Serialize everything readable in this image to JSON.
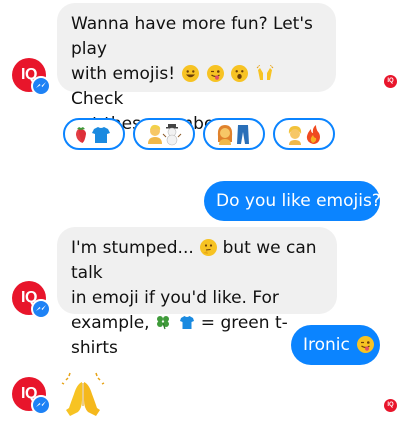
{
  "conversation": {
    "bot_avatar_text": "IQ",
    "receipt_text": "IQ",
    "messages": {
      "m1": {
        "line1": "Wanna have more fun? Let's play",
        "line2_text": "with emojis!",
        "line2_after": "Check",
        "line3": "out these combos."
      },
      "m2": {
        "text": "Do you like emojis?"
      },
      "m3": {
        "line1_text": "I'm stumped...",
        "line1_after": "but we can talk",
        "line2": "in emoji if you'd like. For",
        "line3_before": "example,",
        "line3_after": "= green t-shirts"
      },
      "m4": {
        "text": "Ironic"
      }
    },
    "quick_replies": [
      {
        "icons": [
          "strawberry",
          "t-shirt"
        ]
      },
      {
        "icons": [
          "person-blond",
          "snowman"
        ]
      },
      {
        "icons": [
          "woman-red-hair",
          "jeans"
        ]
      },
      {
        "icons": [
          "girl-blond",
          "fire"
        ]
      }
    ]
  },
  "colors": {
    "brand_red": "#e8152b",
    "messenger_blue": "#0b84ff",
    "incoming_bubble": "#f0f0f0"
  }
}
